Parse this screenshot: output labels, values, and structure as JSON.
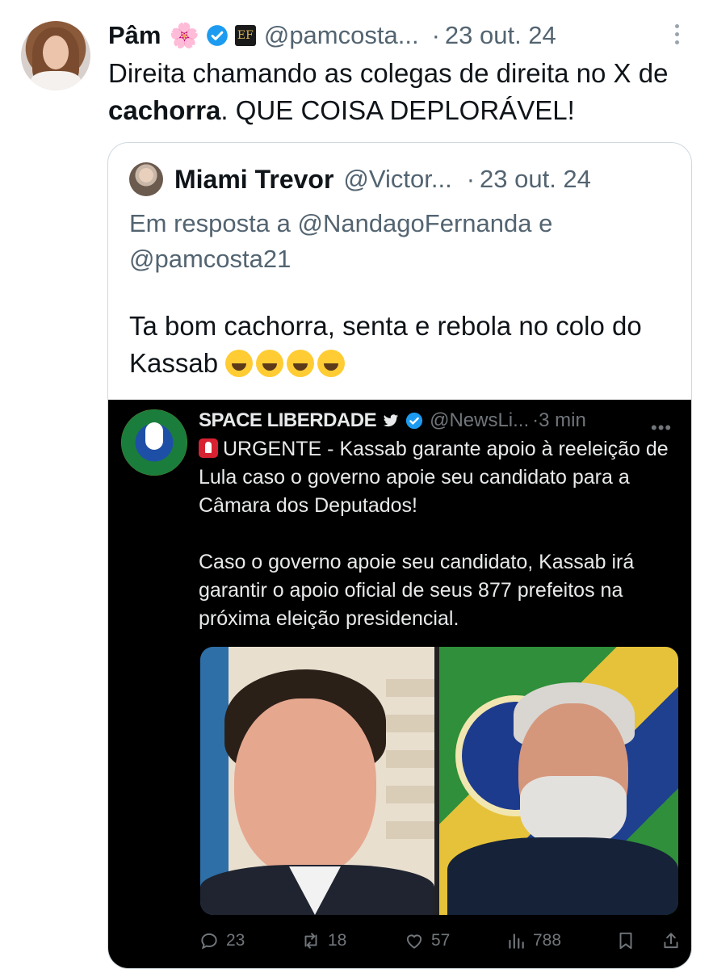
{
  "tweet": {
    "author_name": "Pâm",
    "flower_emoji": "🌸",
    "handle": "@pamcosta...",
    "separator": "·",
    "time": "23 out. 24",
    "text_part1": "Direita chamando as colegas de direita no X de ",
    "text_bold": "cachorra",
    "text_part2": ". QUE COISA DEPLORÁVEL!"
  },
  "quote": {
    "author_name": "Miami Trevor",
    "handle": "@Victor...",
    "separator": "·",
    "time": "23 out. 24",
    "reply_line1": "Em resposta a @NandagoFernanda e",
    "reply_line2": "@pamcosta21",
    "text": "Ta bom cachorra, senta e rebola no colo do Kassab "
  },
  "embedded": {
    "author_name": "SPACE LIBERDADE",
    "handle": "@NewsLi...",
    "time": "·3 min",
    "more": "•••",
    "para1": "URGENTE - Kassab garante apoio à reeleição de Lula caso o governo apoie seu candidato para a Câmara dos Deputados!",
    "para2": "Caso o governo apoie seu candidato, Kassab irá garantir o apoio oficial de seus 877 prefeitos na próxima eleição presidencial.",
    "actions": {
      "replies": "23",
      "retweets": "18",
      "likes": "57",
      "views": "788"
    }
  },
  "colors": {
    "text": "#0f1419",
    "secondary": "#536471",
    "verified": "#1d9bf0",
    "border": "#cfd9de"
  }
}
